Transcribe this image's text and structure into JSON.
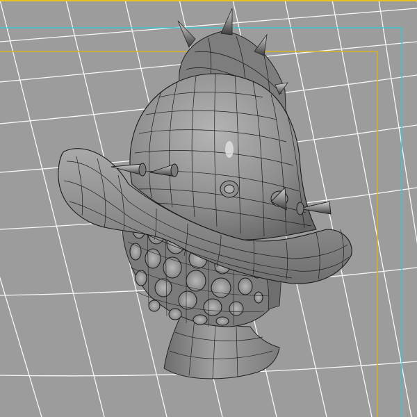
{
  "viewport": {
    "name": "perspective-3d-viewport",
    "background": "#9c9c9c",
    "grid_color": "#ffffff",
    "safe_frame_color": "#35c9d6",
    "title_safe_color": "#d8b51a",
    "top_edge_color": "#e8c21e"
  },
  "model": {
    "subject": "spiked-gladiator-helmet",
    "shading": "smooth-shaded-with-wireframe-on-shaded",
    "surface_color": "#8a8a8a",
    "wire_color": "#1a1a1a",
    "spike_count": 10,
    "visor_holes_visible": 22
  }
}
